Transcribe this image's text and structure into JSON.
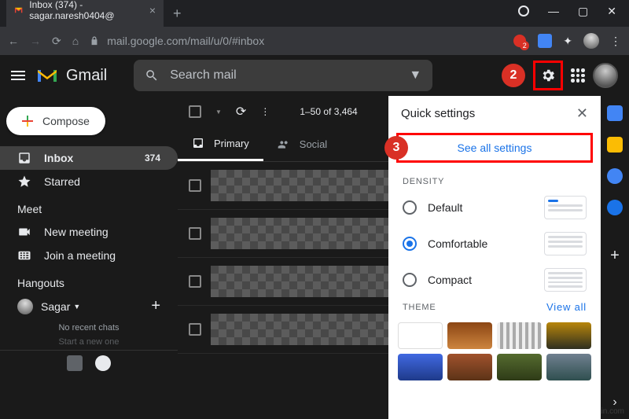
{
  "browser": {
    "tab_title": "Inbox (374) - sagar.naresh0404@",
    "url": "mail.google.com/mail/u/0/#inbox",
    "ext_badge": "2"
  },
  "header": {
    "app_name": "Gmail",
    "search_placeholder": "Search mail",
    "markers": {
      "two": "2",
      "three": "3"
    }
  },
  "sidebar": {
    "compose": "Compose",
    "items": [
      {
        "label": "Inbox",
        "badge": "374"
      },
      {
        "label": "Starred"
      }
    ],
    "meet_title": "Meet",
    "meet": [
      {
        "label": "New meeting"
      },
      {
        "label": "Join a meeting"
      }
    ],
    "hangouts_title": "Hangouts",
    "hangouts_user": "Sagar",
    "no_recent": "No recent chats",
    "start_new": "Start a new one"
  },
  "content": {
    "range": "1–50 of 3,464",
    "tabs": [
      {
        "label": "Primary"
      },
      {
        "label": "Social"
      }
    ]
  },
  "panel": {
    "title": "Quick settings",
    "see_all": "See all settings",
    "density_title": "DENSITY",
    "density": [
      {
        "label": "Default"
      },
      {
        "label": "Comfortable"
      },
      {
        "label": "Compact"
      }
    ],
    "theme_title": "THEME",
    "view_all": "View all"
  },
  "watermark": "wsxin.com"
}
